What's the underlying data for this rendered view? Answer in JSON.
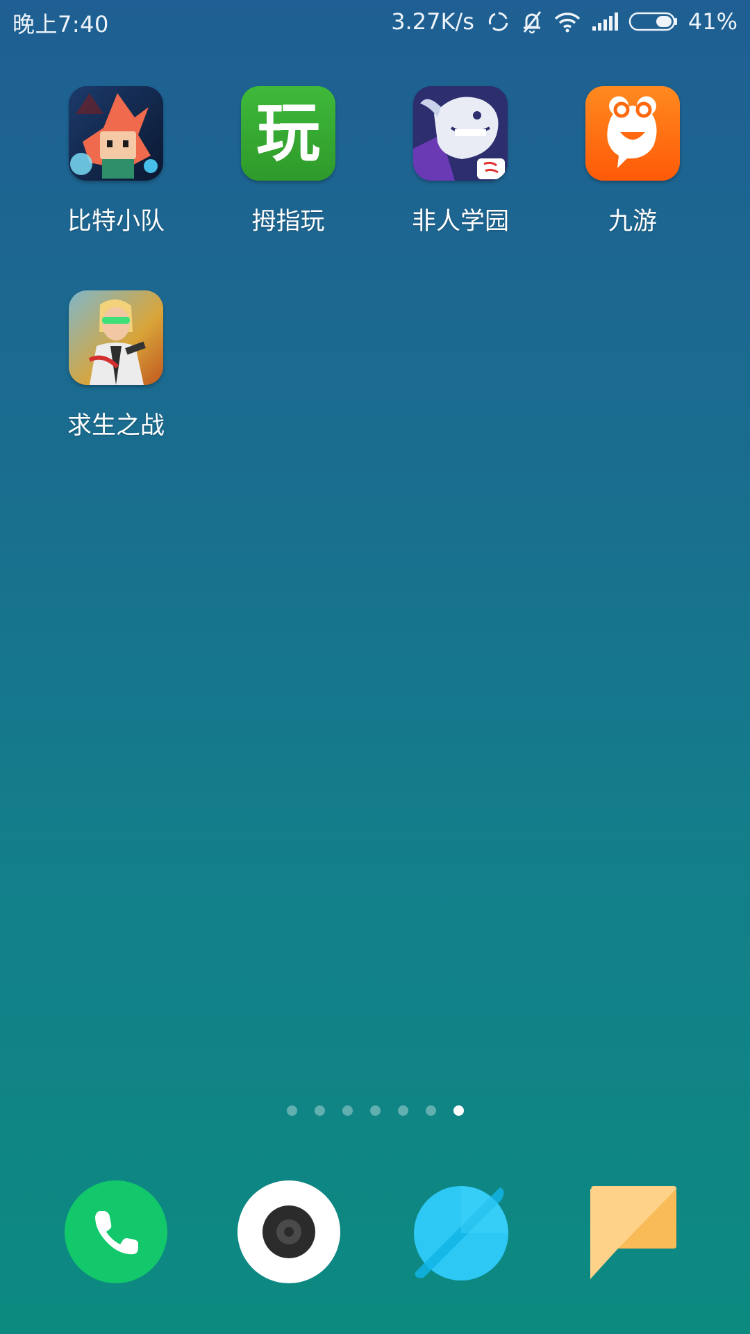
{
  "status_bar": {
    "time": "晚上7:40",
    "net_speed": "3.27K/s",
    "battery_percent": "41%",
    "battery_level": 0.41,
    "icons": [
      "sync-icon",
      "bell-muted-icon",
      "wifi-icon",
      "signal-icon",
      "battery-icon"
    ]
  },
  "home_screen": {
    "apps": [
      {
        "label": "比特小队",
        "icon": "bit-squad-game-icon"
      },
      {
        "label": "拇指玩",
        "icon": "muzhiwan-app-icon",
        "icon_glyph": "玩"
      },
      {
        "label": "非人学园",
        "icon": "feiren-xueyuan-game-icon"
      },
      {
        "label": "九游",
        "icon": "jiuyou-app-icon"
      },
      {
        "label": "求生之战",
        "icon": "qiusheng-zhizhan-game-icon"
      }
    ],
    "page_indicator": {
      "total": 7,
      "current": 7
    }
  },
  "dock": {
    "items": [
      {
        "name": "phone",
        "icon": "phone-icon",
        "color": "#13c76b"
      },
      {
        "name": "camera",
        "icon": "camera-icon",
        "color": "#ffffff"
      },
      {
        "name": "browser",
        "icon": "browser-planet-icon",
        "color": "#2ec8f5"
      },
      {
        "name": "messages",
        "icon": "message-bubble-icon",
        "color": "#fbbf5c"
      }
    ]
  }
}
